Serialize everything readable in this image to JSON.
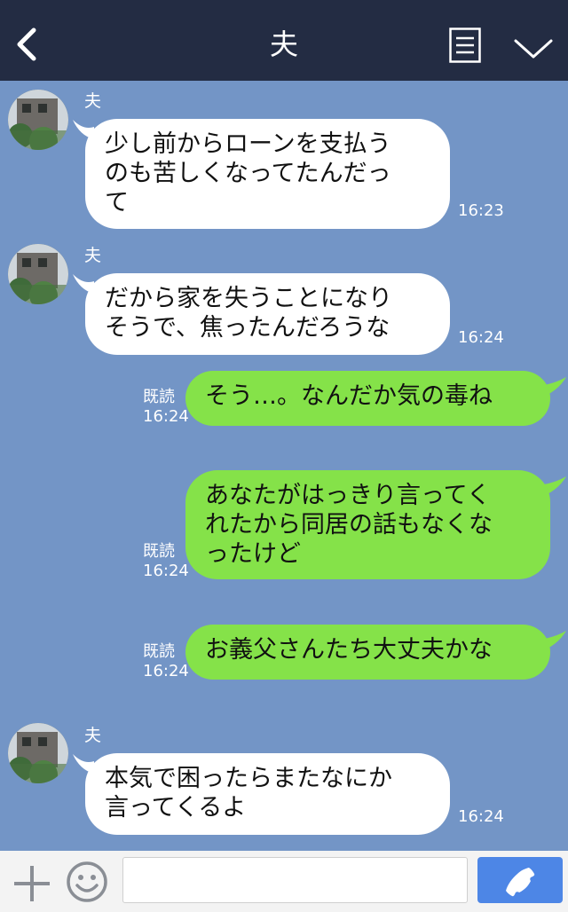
{
  "header": {
    "title": "夫",
    "back_icon": "chevron-left-icon",
    "menu_icon": "menu-lines-icon",
    "collapse_icon": "chevron-down-icon"
  },
  "messages": [
    {
      "direction": "in",
      "sender": "夫",
      "text": "少し前からローンを支払う\nのも苦しくなってたんだっ\nて",
      "time": "16:23"
    },
    {
      "direction": "in",
      "sender": "夫",
      "text": "だから家を失うことになり\nそうで、焦ったんだろうな",
      "time": "16:24"
    },
    {
      "direction": "out",
      "read": "既読",
      "text": "そう…。なんだか気の毒ね",
      "time": "16:24"
    },
    {
      "direction": "out",
      "read": "既読",
      "text": "あなたがはっきり言ってく\nれたから同居の話もなくな\nったけど",
      "time": "16:24"
    },
    {
      "direction": "out",
      "read": "既読",
      "text": "お義父さんたち大丈夫かな",
      "time": "16:24"
    },
    {
      "direction": "in",
      "sender": "夫",
      "text": "本気で困ったらまたなにか\n言ってくるよ",
      "time": "16:24"
    }
  ],
  "input": {
    "placeholder": "",
    "plus_icon": "plus-icon",
    "emoji_icon": "smiley-icon",
    "call_icon": "phone-icon"
  },
  "colors": {
    "header_bg": "#232c43",
    "chat_bg": "#7395c6",
    "incoming_bubble": "#ffffff",
    "outgoing_bubble": "#85e249",
    "call_button": "#4d86e6"
  }
}
